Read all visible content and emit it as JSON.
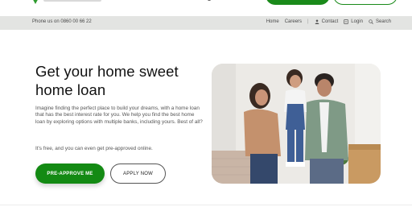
{
  "utility_bar": {
    "phone": "Phone us on 0860 00 66 22",
    "links": {
      "home": "Home",
      "careers": "Careers",
      "separator": "|",
      "contact": "Contact",
      "login": "Login",
      "search": "Search"
    }
  },
  "hero": {
    "title": "Get your home sweet home loan",
    "description": "Imagine finding the perfect place to build your dreams, with a home loan that has the best interest rate for you. We help you find the best home loan by exploring options with multiple banks, including yours. Best of all?",
    "free_text": "It's free, and you can even get pre-approved online.",
    "primary_button": "PRE-APPROVE ME",
    "secondary_button": "APPLY NOW"
  },
  "colors": {
    "brand_green": "#138a13",
    "utility_bar_bg": "#e3e4e2"
  },
  "icons": [
    "logo-icon",
    "user-icon",
    "login-icon",
    "search-icon"
  ]
}
